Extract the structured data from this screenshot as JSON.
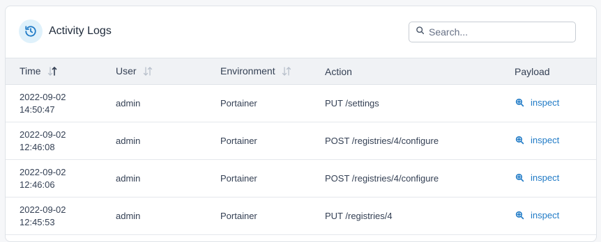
{
  "header": {
    "title": "Activity Logs",
    "icon": "history-icon",
    "accent_color": "#1f7ac6"
  },
  "search": {
    "placeholder": "Search...",
    "value": ""
  },
  "table": {
    "columns": [
      {
        "label": "Time",
        "sortable": true,
        "sort": "desc"
      },
      {
        "label": "User",
        "sortable": true,
        "sort": "none"
      },
      {
        "label": "Environment",
        "sortable": true,
        "sort": "none"
      },
      {
        "label": "Action",
        "sortable": false
      },
      {
        "label": "Payload",
        "sortable": false
      }
    ],
    "rows": [
      {
        "date": "2022-09-02",
        "clock": "14:50:47",
        "user": "admin",
        "environment": "Portainer",
        "action": "PUT /settings",
        "payload": "inspect"
      },
      {
        "date": "2022-09-02",
        "clock": "12:46:08",
        "user": "admin",
        "environment": "Portainer",
        "action": "POST /registries/4/configure",
        "payload": "inspect"
      },
      {
        "date": "2022-09-02",
        "clock": "12:46:06",
        "user": "admin",
        "environment": "Portainer",
        "action": "POST /registries/4/configure",
        "payload": "inspect"
      },
      {
        "date": "2022-09-02",
        "clock": "12:45:53",
        "user": "admin",
        "environment": "Portainer",
        "action": "PUT /registries/4",
        "payload": "inspect"
      }
    ]
  }
}
